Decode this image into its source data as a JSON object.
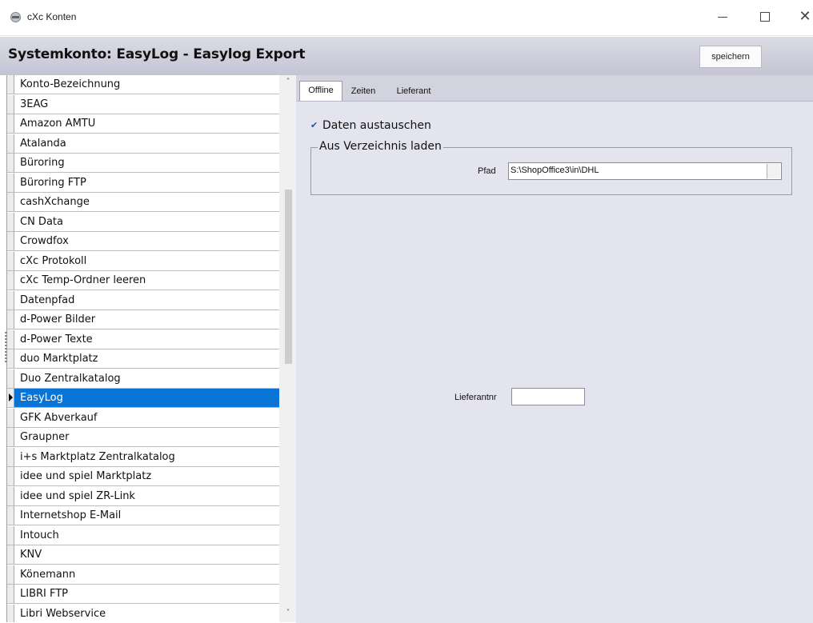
{
  "window": {
    "title": "cXc Konten",
    "icon": "app-icon",
    "controls": [
      "minimize",
      "maximize",
      "close"
    ]
  },
  "header": {
    "title": "Systemkonto: EasyLog - Easylog Export",
    "save_label": "speichern"
  },
  "list": {
    "column_header": "Konto-Bezeichnung",
    "selected": "EasyLog",
    "items": [
      "3EAG",
      "Amazon AMTU",
      "Atalanda",
      "Büroring",
      "Büroring FTP",
      "cashXchange",
      "CN Data",
      "Crowdfox",
      "cXc Protokoll",
      "cXc Temp-Ordner leeren",
      "Datenpfad",
      "d-Power Bilder",
      "d-Power Texte",
      "duo Marktplatz",
      "Duo Zentralkatalog",
      "EasyLog",
      "GFK Abverkauf",
      "Graupner",
      "i+s Marktplatz Zentralkatalog",
      "idee und spiel Marktplatz",
      "idee und spiel ZR-Link",
      "Internetshop E-Mail",
      "Intouch",
      "KNV",
      "Könemann",
      "LIBRI FTP",
      "Libri Webservice"
    ]
  },
  "tabs": [
    {
      "label": "Offline",
      "active": true
    },
    {
      "label": "Zeiten",
      "active": false
    },
    {
      "label": "Lieferant",
      "active": false
    }
  ],
  "offline": {
    "checkbox_label": "Daten austauschen",
    "checkbox_checked": true,
    "group_title": "Aus Verzeichnis laden",
    "pfad_label": "Pfad",
    "pfad_value": "S:\\ShopOffice3\\in\\DHL",
    "lieferantnr_label": "Lieferantnr",
    "lieferantnr_value": ""
  },
  "colors": {
    "selection": "#0a74d6",
    "header_band": "#c8c8d8",
    "panel_bg": "#e4e4ee"
  }
}
